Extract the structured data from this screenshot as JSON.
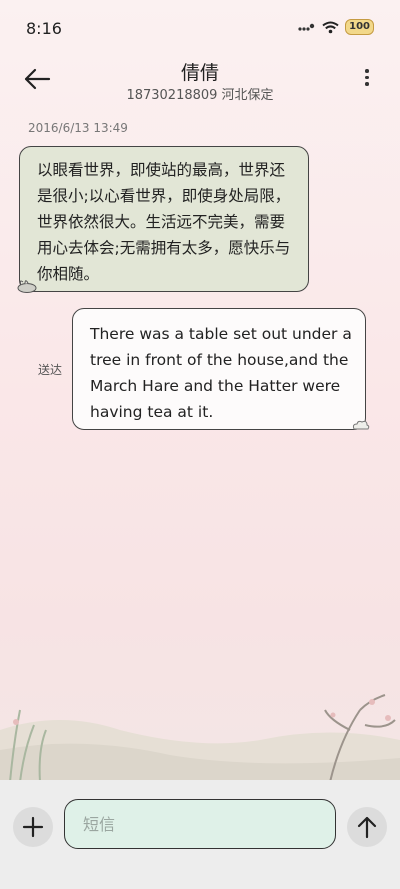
{
  "status_bar": {
    "time": "8:16",
    "battery": "100"
  },
  "header": {
    "title": "倩倩",
    "subtitle": "18730218809 河北保定"
  },
  "messages": [
    {
      "timestamp": "2016/6/13 13:49",
      "text": "以眼看世界，即使站的最高，世界还是很小;以心看世界，即使身处局限，世界依然很大。生活远不完美，需要用心去体会;无需拥有太多，愿快乐与你相随。"
    },
    {
      "status": "送达",
      "text": "There was a table set out under a tree in front of the house,and the March Hare and the Hatter were having tea at it."
    }
  ],
  "composer": {
    "placeholder": "短信"
  },
  "icons": {
    "back": "arrow-left-icon",
    "more": "more-vertical-icon",
    "add": "plus-icon",
    "send": "arrow-up-icon",
    "signal": "signal-icon",
    "wifi": "wifi-icon",
    "battery": "battery-icon"
  },
  "colors": {
    "incoming_bubble": "#e2e6d6",
    "outgoing_bubble": "#fdfbfb",
    "input_bg": "#dff1e8"
  }
}
